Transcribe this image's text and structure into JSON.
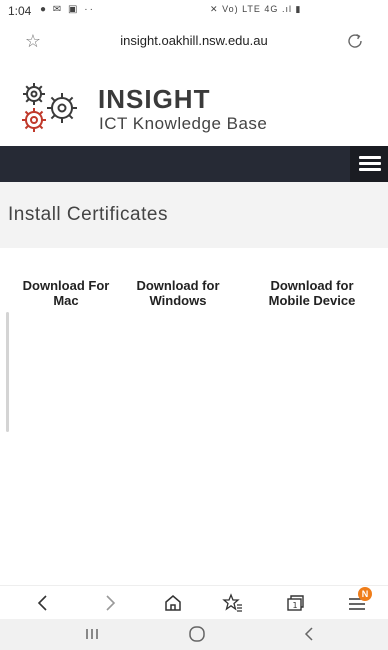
{
  "status_bar": {
    "time": "1:04",
    "network_text": "Vo) LTE 4G"
  },
  "browser": {
    "url": "insight.oakhill.nsw.edu.au",
    "menu_badge": "N"
  },
  "site": {
    "brand_title": "INSIGHT",
    "brand_subtitle": "ICT Knowledge Base",
    "nav_color": "#262a35"
  },
  "page": {
    "title": "Install Certificates",
    "downloads": [
      {
        "label": "Download For Mac"
      },
      {
        "label": "Download for Windows"
      },
      {
        "label": "Download for Mobile Device"
      }
    ]
  },
  "colors": {
    "accent_badge": "#ef7d1a",
    "gear_red": "#c0392b",
    "gear_dark": "#3a3a3a"
  }
}
